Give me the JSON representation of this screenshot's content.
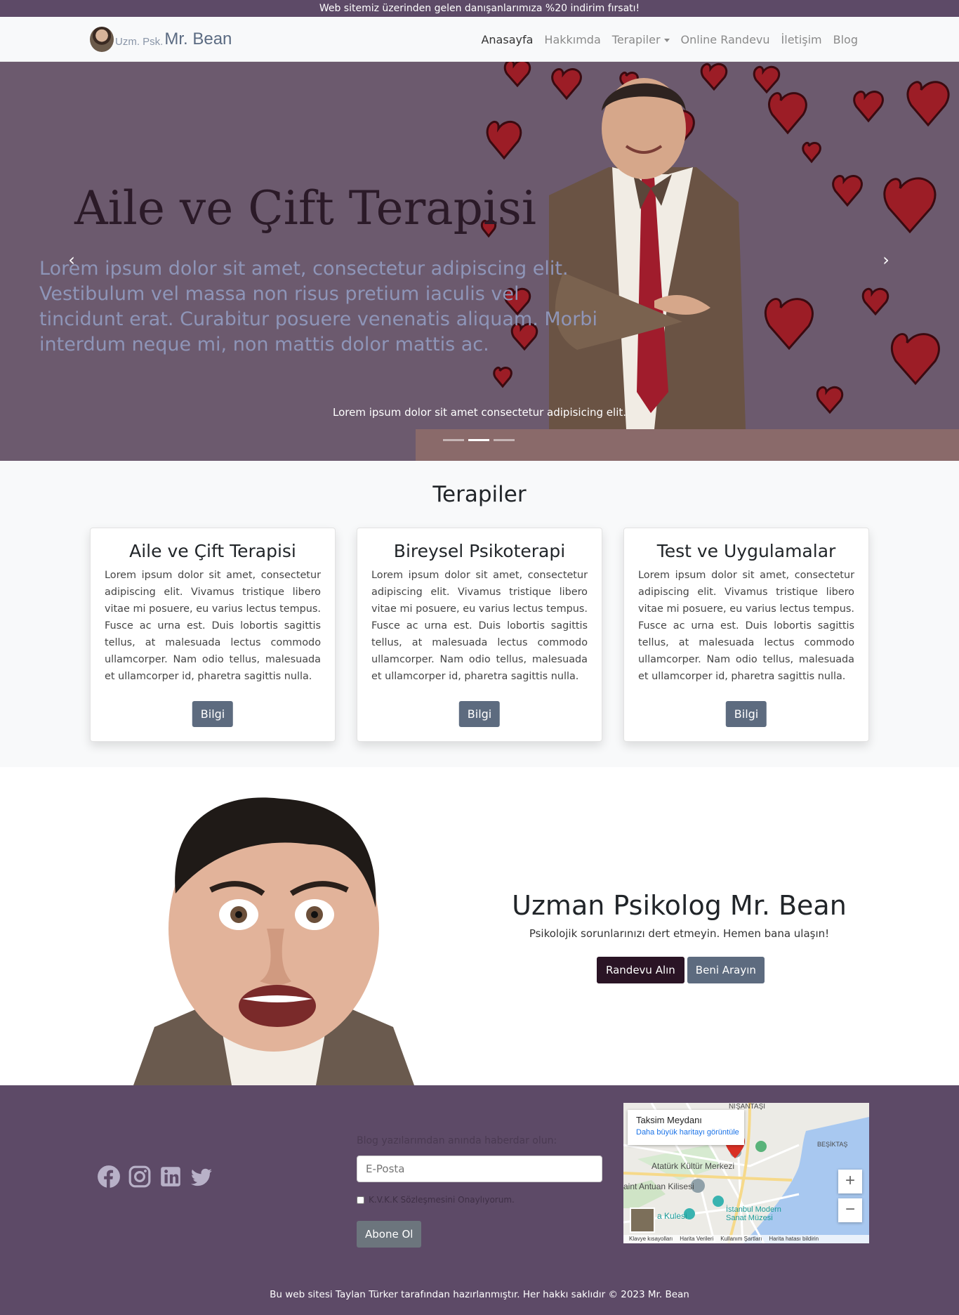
{
  "announcement": "Web sitemiz üzerinden gelen danışanlarımıza %20 indirim fırsatı!",
  "brand": {
    "small": "Uzm. Psk.",
    "name": "Mr. Bean"
  },
  "nav": [
    "Anasayfa",
    "Hakkımda",
    "Terapiler",
    "Online Randevu",
    "İletişim",
    "Blog"
  ],
  "hero": {
    "title": "Aile ve Çift Terapisi",
    "text": "Lorem ipsum dolor sit amet, consectetur adipiscing elit. Vestibulum vel massa non risus pretium iaculis vel tincidunt erat. Curabitur posuere venenatis aliquam. Morbi interdum neque mi, non mattis dolor mattis ac.",
    "caption": "Lorem ipsum dolor sit amet consectetur adipisicing elit.",
    "active_slide": 2,
    "slide_count": 3
  },
  "therapies": {
    "title": "Terapiler",
    "cards": [
      {
        "title": "Aile ve Çift Terapisi",
        "text": "Lorem ipsum dolor sit amet, consectetur adipiscing elit. Vivamus tristique libero vitae mi posuere, eu varius lectus tempus. Fusce ac urna est. Duis lobortis sagittis tellus, at malesuada lectus commodo ullamcorper. Nam odio tellus, malesuada et ullamcorper id, pharetra sagittis nulla.",
        "button": "Bilgi"
      },
      {
        "title": "Bireysel Psikoterapi",
        "text": "Lorem ipsum dolor sit amet, consectetur adipiscing elit. Vivamus tristique libero vitae mi posuere, eu varius lectus tempus. Fusce ac urna est. Duis lobortis sagittis tellus, at malesuada lectus commodo ullamcorper. Nam odio tellus, malesuada et ullamcorper id, pharetra sagittis nulla.",
        "button": "Bilgi"
      },
      {
        "title": "Test ve Uygulamalar",
        "text": "Lorem ipsum dolor sit amet, consectetur adipiscing elit. Vivamus tristique libero vitae mi posuere, eu varius lectus tempus. Fusce ac urna est. Duis lobortis sagittis tellus, at malesuada lectus commodo ullamcorper. Nam odio tellus, malesuada et ullamcorper id, pharetra sagittis nulla.",
        "button": "Bilgi"
      }
    ]
  },
  "expert": {
    "title": "Uzman Psikolog Mr. Bean",
    "subtitle": "Psikolojik sorunlarınızı dert etmeyin. Hemen bana ulaşın!",
    "btn_appointment": "Randevu Alın",
    "btn_call": "Beni Arayın"
  },
  "footer": {
    "socials": [
      "facebook-icon",
      "instagram-icon",
      "linkedin-icon",
      "twitter-icon"
    ],
    "newsletter_label": "Blog yazılarımdan anında haberdar olun:",
    "email_placeholder": "E-Posta",
    "kvkk_label": "K.V.K.K Sözleşmesini Onaylıyorum.",
    "subscribe": "Abone Ol",
    "copyright": "Bu web sitesi Taylan Türker tarafından hazırlanmıştır. Her hakkı saklıdır © 2023 Mr. Bean"
  },
  "map": {
    "place": "Taksim Meydanı",
    "link": "Daha büyük haritayı görüntüle",
    "labels": [
      "NIŞANTAŞI",
      "BEŞİKTAŞ",
      "Atatürk Kültür Merkezi",
      "aint Antuan Kilisesi",
      "a Kulesi",
      "İstanbul Modern Sanat Müzesi"
    ],
    "footer": [
      "Klavye kısayolları",
      "Harita Verileri",
      "Kullanım Şartları",
      "Harita hatası bildirin"
    ],
    "zoom_in": "+",
    "zoom_out": "−"
  },
  "colors": {
    "brand_purple": "#5d4a67",
    "slate_button": "#5d6b7f",
    "dark_button": "#2a1425"
  }
}
